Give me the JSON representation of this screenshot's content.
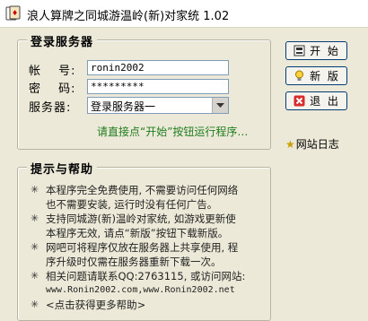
{
  "window": {
    "title": "浪人算牌之同城游温岭(新)对家统 1.02",
    "icon": "app-card-icon"
  },
  "login": {
    "group_title": "登录服务器",
    "username_label": "帐　 号:",
    "password_label": "密　 码:",
    "server_label": "服务器:",
    "username_value": "ronin2002",
    "password_value": "*********",
    "server_value": "登录服务器一",
    "hint": "请直接点“开始”按钮运行程序…"
  },
  "buttons": {
    "start_label": "开 始",
    "new_label": "新 版",
    "exit_label": "退 出",
    "site_log_label": "网站日志"
  },
  "help": {
    "group_title": "提示与帮助",
    "items": [
      {
        "line1": "本程序完全免费使用, 不需要访问任何网络",
        "line2": "也不需要安装, 运行时没有任何广告。"
      },
      {
        "line1": "支持同城游(新)温岭对家统, 如游戏更新使",
        "line2": "本程序无效, 请点“新版”按钮下载新版。"
      },
      {
        "line1": "网吧可将程序仅放在服务器上共享使用, 程",
        "line2": "序升级时仅需在服务器重新下载一次。"
      },
      {
        "line1": "相关问题请联系QQ:2763115, 或访问网站:",
        "line2": "www.Ronin2002.com,www.Ronin2002.net"
      },
      {
        "line1": "<点击获得更多帮助>",
        "line2": ""
      }
    ]
  },
  "colors": {
    "hint_green": "#1e7d1e",
    "window_bg": "#ece9d8",
    "button_border": "#003c74"
  }
}
